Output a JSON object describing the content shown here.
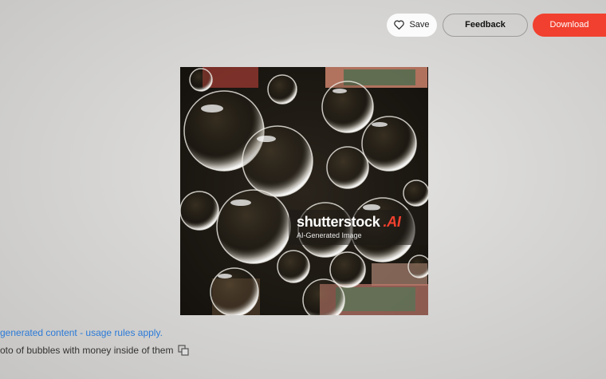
{
  "toolbar": {
    "save_label": "Save",
    "feedback_label": "Feedback",
    "download_label": "Download",
    "accent_color": "#f1402f"
  },
  "image": {
    "watermark_brand": "shutterstock",
    "watermark_ai": ".AI",
    "watermark_subtitle": "AI-Generated Image"
  },
  "notice": "generated content - usage rules apply.",
  "caption": "oto of bubbles with money inside of them",
  "icons": [
    "heart-icon",
    "copy-icon"
  ]
}
